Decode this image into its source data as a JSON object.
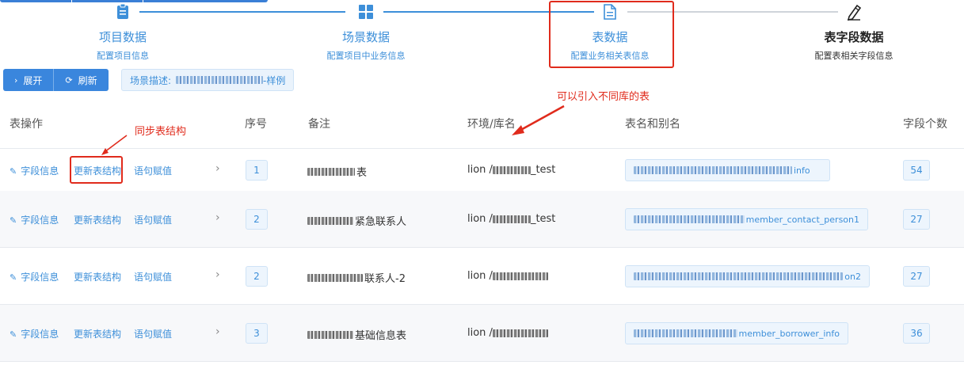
{
  "steps": [
    {
      "title": "项目数据",
      "subtitle": "配置项目信息",
      "icon": "clipboard-icon"
    },
    {
      "title": "场景数据",
      "subtitle": "配置项目中业务信息",
      "icon": "grid-icon"
    },
    {
      "title": "表数据",
      "subtitle": "配置业务相关表信息",
      "icon": "document-icon"
    },
    {
      "title": "表字段数据",
      "subtitle": "配置表相关字段信息",
      "icon": "pencil-icon"
    }
  ],
  "colors": {
    "primary": "#3d8fd9",
    "annotation": "#e02b1c",
    "active_text": "#222222"
  },
  "toolbar": {
    "expand_label": "展开",
    "refresh_label": "刷新",
    "scene_prefix": "场景描述:",
    "scene_suffix": "-样例"
  },
  "annotations": {
    "cross_db": "可以引入不同库的表",
    "sync": "同步表结构"
  },
  "table": {
    "headers": {
      "ops": "表操作",
      "index": "序号",
      "note": "备注",
      "env": "环境/库名",
      "name": "表名和别名",
      "count": "字段个数"
    },
    "op_labels": {
      "field": "字段信息",
      "update": "更新表结构",
      "stmt": "语句赋值"
    },
    "rows": [
      {
        "index": "1",
        "note": "表",
        "env_prefix": "lion / ",
        "env_suffix": "_test",
        "name_suffix": "info",
        "count": "54"
      },
      {
        "index": "2",
        "note": "紧急联系人",
        "env_prefix": "lion / ",
        "env_suffix": "_test",
        "name_suffix": "member_contact_person1",
        "count": "27"
      },
      {
        "index": "2",
        "note": "联系人-2",
        "env_prefix": "lion / ",
        "env_suffix": "",
        "name_suffix": "on2",
        "count": "27"
      },
      {
        "index": "3",
        "note": "基础信息表",
        "env_prefix": "lion / ",
        "env_suffix": "",
        "name_suffix": "member_borrower_info",
        "count": "36"
      }
    ]
  }
}
